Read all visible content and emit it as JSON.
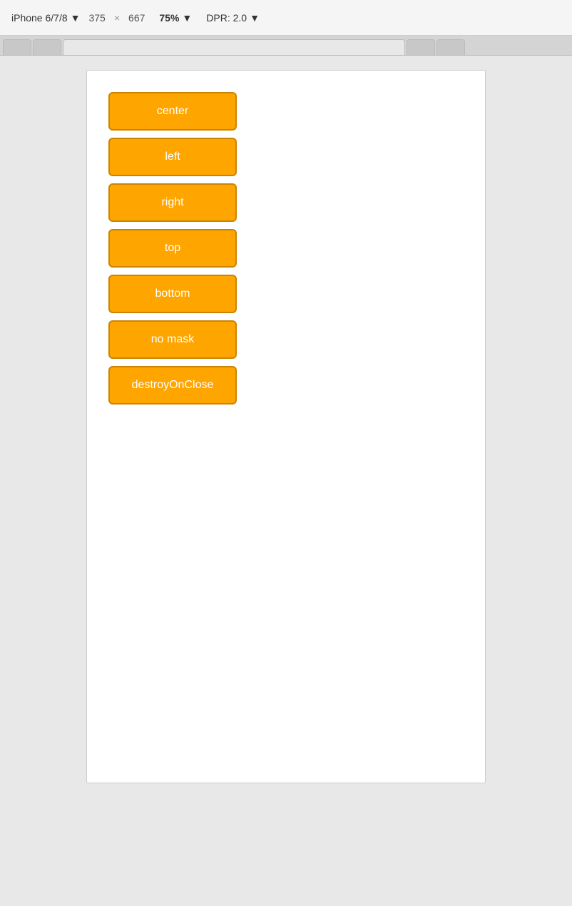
{
  "toolbar": {
    "device_label": "iPhone 6/7/8",
    "device_dropdown": "▼",
    "width": "375",
    "x_separator": "×",
    "height": "667",
    "zoom_label": "75%",
    "zoom_dropdown": "▼",
    "dpr_label": "DPR: 2.0",
    "dpr_dropdown": "▼"
  },
  "buttons": [
    {
      "id": "btn-center",
      "label": "center"
    },
    {
      "id": "btn-left",
      "label": "left"
    },
    {
      "id": "btn-right",
      "label": "right"
    },
    {
      "id": "btn-top",
      "label": "top"
    },
    {
      "id": "btn-bottom",
      "label": "bottom"
    },
    {
      "id": "btn-no-mask",
      "label": "no mask"
    },
    {
      "id": "btn-destroy-on-close",
      "label": "destroyOnClose"
    }
  ]
}
